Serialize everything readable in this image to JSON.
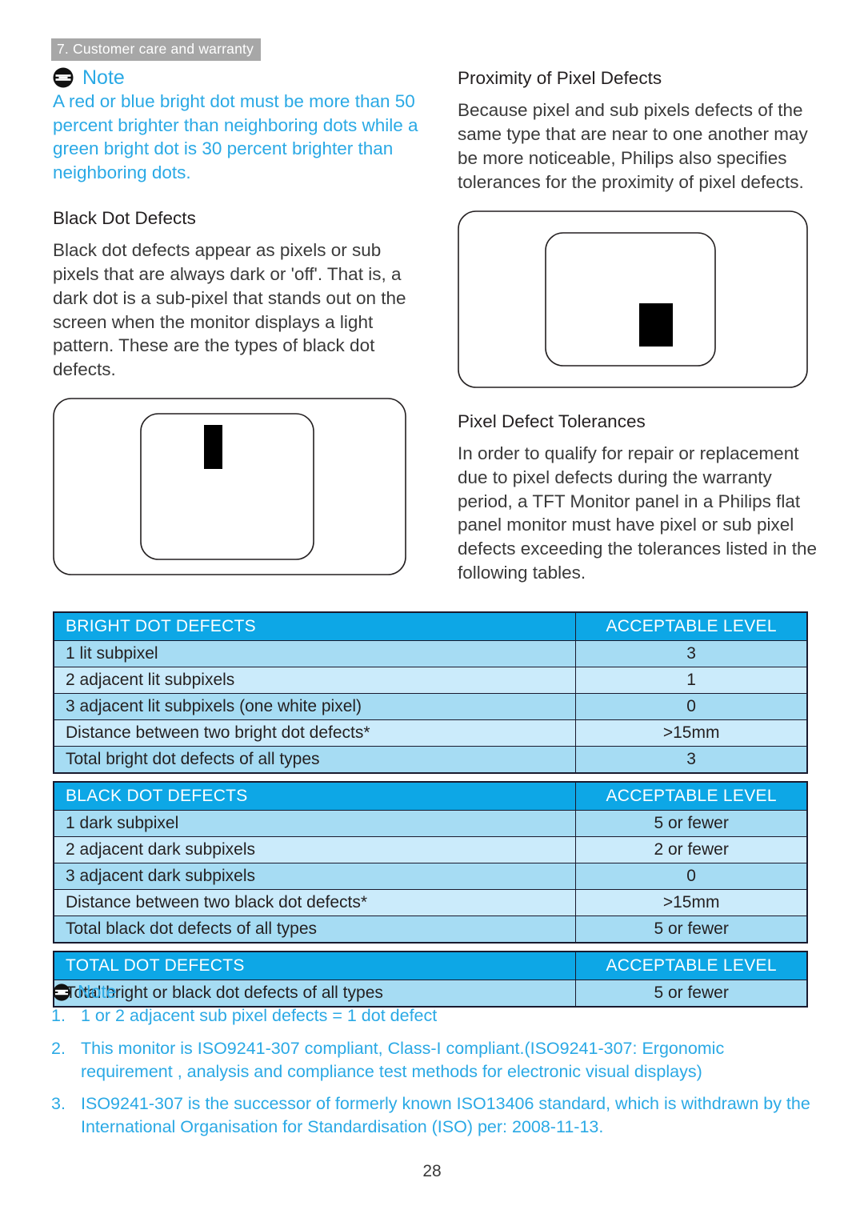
{
  "running_header": "7. Customer care and warranty",
  "colors": {
    "accent_blue": "#2AA9E5",
    "table_header_blue": "#0DA7E6",
    "table_row_medium": "#A6DCF3",
    "table_row_light": "#CBEBFB",
    "header_band_gray": "#A7A7A7",
    "border": "#1A1A2E"
  },
  "left_column": {
    "note": {
      "title": "Note",
      "body": "A red or blue bright dot must be more than 50 percent brighter than neighboring dots while a green bright dot is 30 percent brighter than neighboring dots."
    },
    "section": {
      "heading": "Black Dot Defects",
      "body": "Black dot defects appear as pixels or sub pixels that are always dark or 'off'. That is, a dark dot is a sub-pixel that stands out on the screen when the monitor displays a light pattern. These are the types of black dot defects."
    },
    "figure_caption": ""
  },
  "right_column": {
    "section_one": {
      "heading": "Proximity of Pixel Defects",
      "body": "Because pixel and sub pixels defects of the same type that are near to one another may be more noticeable, Philips also specifies tolerances for the proximity of pixel defects."
    },
    "section_two": {
      "heading": "Pixel Defect Tolerances",
      "body": "In order to qualify for repair or replacement due to pixel defects during the warranty period, a TFT Monitor panel in a Philips flat panel monitor must have pixel or sub pixel defects exceeding the tolerances listed in the following tables."
    }
  },
  "tables": [
    {
      "id": "bright-dot-defects",
      "headers": [
        "BRIGHT DOT DEFECTS",
        "ACCEPTABLE LEVEL"
      ],
      "rows": [
        [
          "1 lit subpixel",
          "3"
        ],
        [
          "2 adjacent lit subpixels",
          "1"
        ],
        [
          "3 adjacent lit subpixels (one white pixel)",
          "0"
        ],
        [
          "Distance between two bright dot defects*",
          ">15mm"
        ],
        [
          "Total bright dot defects of all types",
          "3"
        ]
      ]
    },
    {
      "id": "black-dot-defects",
      "headers": [
        "BLACK DOT DEFECTS",
        "ACCEPTABLE LEVEL"
      ],
      "rows": [
        [
          "1 dark subpixel",
          "5 or fewer"
        ],
        [
          "2 adjacent dark subpixels",
          "2 or fewer"
        ],
        [
          "3 adjacent dark subpixels",
          "0"
        ],
        [
          "Distance between two black dot defects*",
          ">15mm"
        ],
        [
          "Total black dot defects of all types",
          "5 or fewer"
        ]
      ]
    },
    {
      "id": "total-dot-defects",
      "headers": [
        "TOTAL DOT DEFECTS",
        "ACCEPTABLE LEVEL"
      ],
      "rows": [
        [
          "Total bright or black dot defects of all types",
          "5 or fewer"
        ]
      ]
    }
  ],
  "bottom_note": {
    "title": "Note",
    "items": [
      {
        "num": "1.",
        "text": "1 or 2 adjacent sub pixel defects = 1 dot defect"
      },
      {
        "num": "2.",
        "text": "This monitor is ISO9241-307 compliant, Class-I compliant.(ISO9241-307: Ergonomic requirement , analysis and compliance test methods for electronic visual displays)"
      },
      {
        "num": "3.",
        "text": "ISO9241-307 is the successor of formerly known ISO13406 standard, which is withdrawn by the International Organisation for Standardisation (ISO) per: 2008-11-13."
      }
    ]
  },
  "page_number": "28"
}
